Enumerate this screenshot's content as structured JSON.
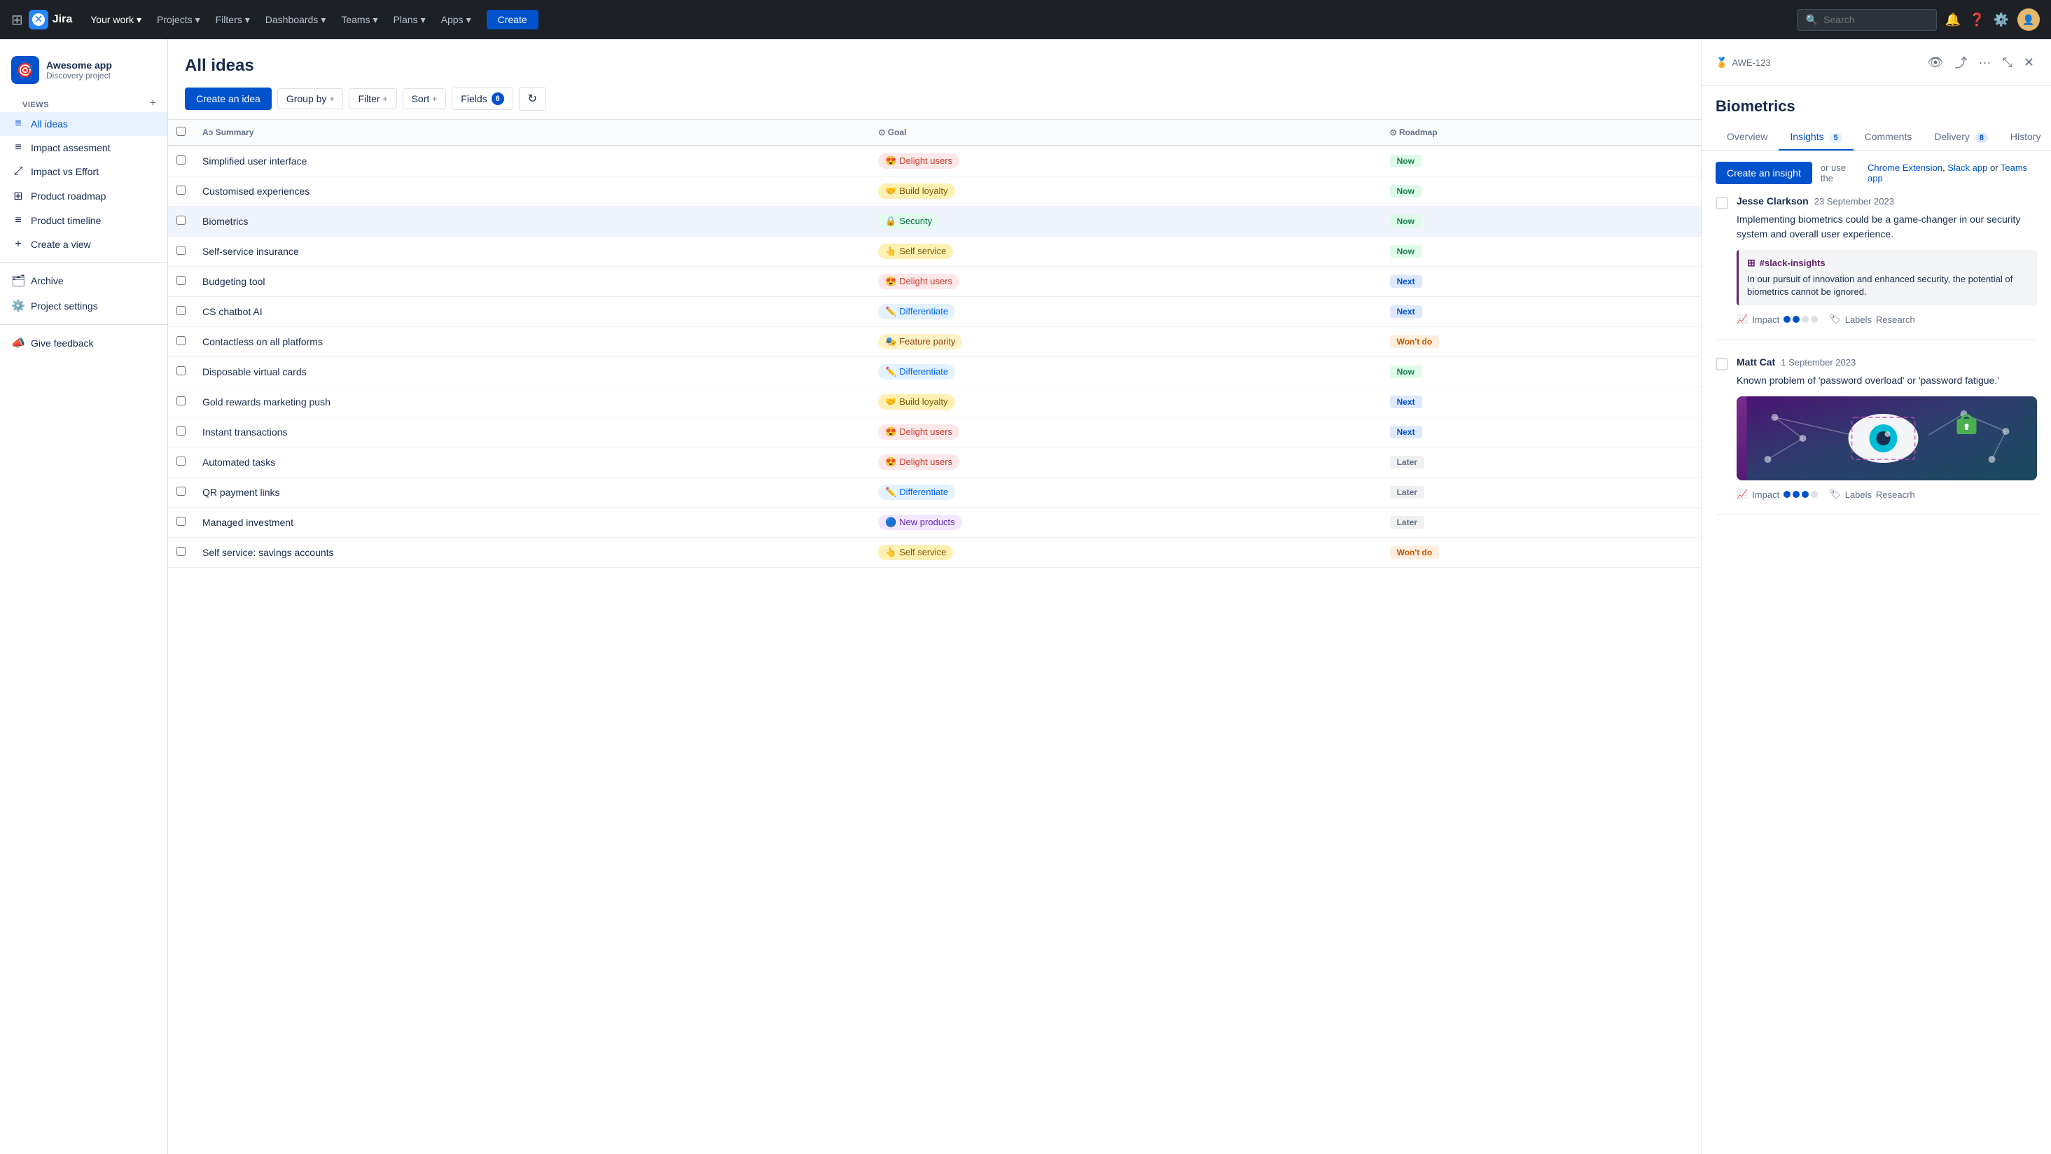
{
  "nav": {
    "logo_text": "Jira",
    "menu_items": [
      {
        "label": "Your work",
        "has_dropdown": true
      },
      {
        "label": "Projects",
        "has_dropdown": true,
        "active": true
      },
      {
        "label": "Filters",
        "has_dropdown": true
      },
      {
        "label": "Dashboards",
        "has_dropdown": true
      },
      {
        "label": "Teams",
        "has_dropdown": true
      },
      {
        "label": "Plans",
        "has_dropdown": true
      },
      {
        "label": "Apps",
        "has_dropdown": true
      }
    ],
    "create_label": "Create",
    "search_placeholder": "Search"
  },
  "sidebar": {
    "project_name": "Awesome app",
    "project_type": "Discovery project",
    "views_label": "VIEWS",
    "nav_items": [
      {
        "label": "All ideas",
        "icon": "≡",
        "active": true
      },
      {
        "label": "Impact assesment",
        "icon": "≡"
      },
      {
        "label": "Impact vs Effort",
        "icon": "⤢"
      },
      {
        "label": "Product roadmap",
        "icon": "⊞"
      },
      {
        "label": "Product timeline",
        "icon": "≡"
      },
      {
        "label": "Create a view",
        "icon": "+"
      }
    ],
    "archive_label": "Archive",
    "settings_label": "Project settings",
    "feedback_label": "Give feedback"
  },
  "main": {
    "title": "All ideas",
    "toolbar": {
      "create_idea": "Create an idea",
      "group_by": "Group by",
      "filter": "Filter",
      "sort": "Sort",
      "fields": "Fields",
      "fields_count": "6"
    },
    "table": {
      "columns": [
        "Summary",
        "Goal",
        "Roadmap"
      ],
      "rows": [
        {
          "summary": "Simplified user interface",
          "goal": "Delight users",
          "goal_class": "goal-delight",
          "goal_emoji": "😍",
          "roadmap": "Now",
          "roadmap_class": "roadmap-now"
        },
        {
          "summary": "Customised experiences",
          "goal": "Build loyalty",
          "goal_class": "goal-build",
          "goal_emoji": "🤝",
          "roadmap": "Now",
          "roadmap_class": "roadmap-now"
        },
        {
          "summary": "Biometrics",
          "goal": "Security",
          "goal_class": "goal-security",
          "goal_emoji": "🔒",
          "roadmap": "Now",
          "roadmap_class": "roadmap-now"
        },
        {
          "summary": "Self-service insurance",
          "goal": "Self service",
          "goal_class": "goal-self",
          "goal_emoji": "👆",
          "roadmap": "Now",
          "roadmap_class": "roadmap-now"
        },
        {
          "summary": "Budgeting tool",
          "goal": "Delight users",
          "goal_class": "goal-delight",
          "goal_emoji": "😍",
          "roadmap": "Next",
          "roadmap_class": "roadmap-next"
        },
        {
          "summary": "CS chatbot AI",
          "goal": "Differentiate",
          "goal_class": "goal-differentiate",
          "goal_emoji": "✏️",
          "roadmap": "Next",
          "roadmap_class": "roadmap-next"
        },
        {
          "summary": "Contactless on all platforms",
          "goal": "Feature parity",
          "goal_class": "goal-feature",
          "goal_emoji": "🎭",
          "roadmap": "Won't do",
          "roadmap_class": "roadmap-wontdo"
        },
        {
          "summary": "Disposable virtual cards",
          "goal": "Differentiate",
          "goal_class": "goal-differentiate",
          "goal_emoji": "✏️",
          "roadmap": "Now",
          "roadmap_class": "roadmap-now"
        },
        {
          "summary": "Gold rewards marketing push",
          "goal": "Build loyalty",
          "goal_class": "goal-build",
          "goal_emoji": "🤝",
          "roadmap": "Next",
          "roadmap_class": "roadmap-next"
        },
        {
          "summary": "Instant transactions",
          "goal": "Delight users",
          "goal_class": "goal-delight",
          "goal_emoji": "😍",
          "roadmap": "Next",
          "roadmap_class": "roadmap-next"
        },
        {
          "summary": "Automated tasks",
          "goal": "Delight users",
          "goal_class": "goal-delight",
          "goal_emoji": "😍",
          "roadmap": "Later",
          "roadmap_class": "roadmap-later"
        },
        {
          "summary": "QR payment links",
          "goal": "Differentiate",
          "goal_class": "goal-differentiate",
          "goal_emoji": "✏️",
          "roadmap": "Later",
          "roadmap_class": "roadmap-later"
        },
        {
          "summary": "Managed investment",
          "goal": "New products",
          "goal_class": "goal-new",
          "goal_emoji": "🔵",
          "roadmap": "Later",
          "roadmap_class": "roadmap-later"
        },
        {
          "summary": "Self service: savings accounts",
          "goal": "Self service",
          "goal_class": "goal-self",
          "goal_emoji": "👆",
          "roadmap": "Won't do",
          "roadmap_class": "roadmap-wontdo"
        }
      ]
    }
  },
  "panel": {
    "id": "AWE-123",
    "title": "Biometrics",
    "tabs": [
      {
        "label": "Overview",
        "active": false
      },
      {
        "label": "Insights",
        "badge": "5",
        "active": true
      },
      {
        "label": "Comments",
        "active": false
      },
      {
        "label": "Delivery",
        "badge": "8",
        "active": false
      },
      {
        "label": "History",
        "active": false
      }
    ],
    "insights": {
      "create_btn": "Create an insight",
      "or_text": "or use the",
      "links": [
        "Chrome Extension",
        "Slack app",
        "Teams app"
      ],
      "cards": [
        {
          "author": "Jesse Clarkson",
          "date": "23 September 2023",
          "text": "Implementing biometrics could be a game-changer in our security system and overall user experience.",
          "slack_channel": "#slack-insights",
          "slack_text": "In our pursuit of innovation and enhanced security, the potential of biometrics cannot be ignored.",
          "impact_dots": 2,
          "impact_total": 4,
          "label": "Research"
        },
        {
          "author": "Matt Cat",
          "date": "1 September 2023",
          "text": "Known problem of 'password overload' or 'password fatigue.'",
          "has_thumbnail": true,
          "impact_dots": 3,
          "impact_total": 4,
          "label": "Reseacrh"
        }
      ]
    }
  }
}
